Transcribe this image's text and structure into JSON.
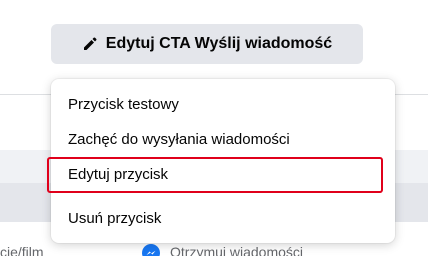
{
  "toolbar": {
    "edit_cta_label": "Edytuj CTA Wyślij wiadomość"
  },
  "menu": {
    "items": [
      {
        "label": "Przycisk testowy"
      },
      {
        "label": "Zachęć do wysyłania wiadomości"
      },
      {
        "label": "Edytuj przycisk"
      },
      {
        "label": "Usuń przycisk"
      }
    ]
  },
  "background": {
    "left_text": "cie/film",
    "right_text": "Otrzymuj wiadomości"
  },
  "icons": {
    "edit": "pencil-icon",
    "messenger": "messenger-icon"
  },
  "colors": {
    "highlight": "#e0001b",
    "button_bg": "#e4e6eb",
    "messenger": "#1877f2"
  }
}
